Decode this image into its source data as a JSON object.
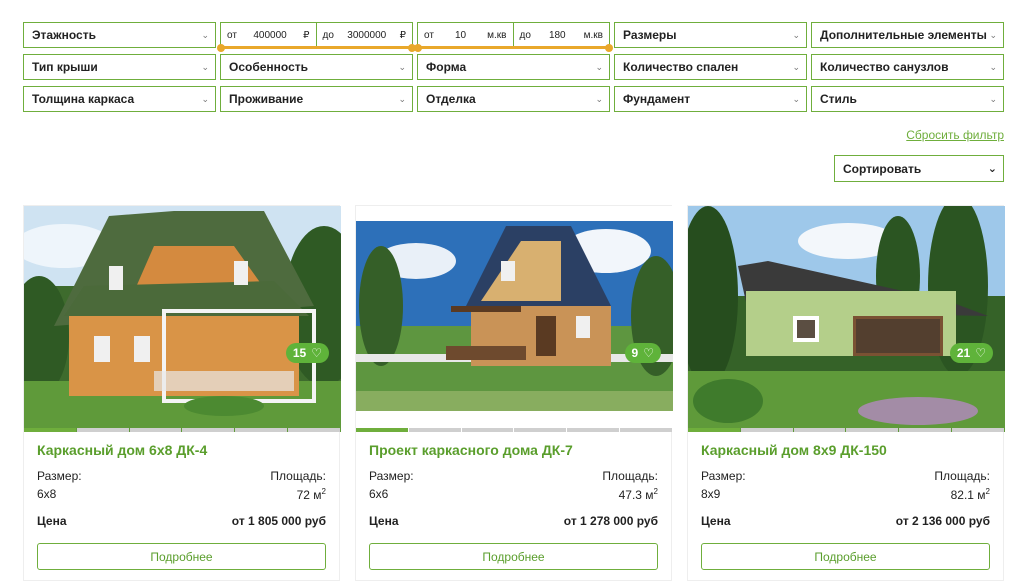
{
  "filters": {
    "row1": {
      "floors": "Этажность",
      "price": {
        "from_label": "от",
        "from_value": "400000",
        "from_unit": "₽",
        "to_label": "до",
        "to_value": "3000000",
        "to_unit": "₽"
      },
      "area": {
        "from_label": "от",
        "from_value": "10",
        "from_unit": "м.кв",
        "to_label": "до",
        "to_value": "180",
        "to_unit": "м.кв"
      },
      "sizes": "Размеры",
      "extras": "Дополнительные элементы"
    },
    "row2": [
      "Тип крыши",
      "Особенность",
      "Форма",
      "Количество спален",
      "Количество санузлов"
    ],
    "row3": [
      "Толщина каркаса",
      "Проживание",
      "Отделка",
      "Фундамент",
      "Стиль"
    ]
  },
  "reset_label": "Сбросить фильтр",
  "sort_label": "Сортировать",
  "cards": [
    {
      "title": "Каркасный дом 6х8 ДК-4",
      "size_label": "Размер:",
      "size": "6х8",
      "area_label": "Площадь:",
      "area": "72 м",
      "area_sup": "2",
      "price_label": "Цена",
      "price": "от 1 805 000 руб",
      "button": "Подробнее",
      "photos": "15"
    },
    {
      "title": "Проект каркасного дома ДК-7",
      "size_label": "Размер:",
      "size": "6х6",
      "area_label": "Площадь:",
      "area": "47.3 м",
      "area_sup": "2",
      "price_label": "Цена",
      "price": "от 1 278 000 руб",
      "button": "Подробнее",
      "photos": "9"
    },
    {
      "title": "Каркасный дом 8х9 ДК-150",
      "size_label": "Размер:",
      "size": "8х9",
      "area_label": "Площадь:",
      "area": "82.1 м",
      "area_sup": "2",
      "price_label": "Цена",
      "price": "от 2 136 000 руб",
      "button": "Подробнее",
      "photos": "21"
    }
  ],
  "colors": {
    "accent": "#6fae3c",
    "range": "#e9a82b",
    "badge": "#5fb33a"
  },
  "icons": {
    "dropdown": "chevron-down-icon",
    "favorite": "heart-icon"
  }
}
